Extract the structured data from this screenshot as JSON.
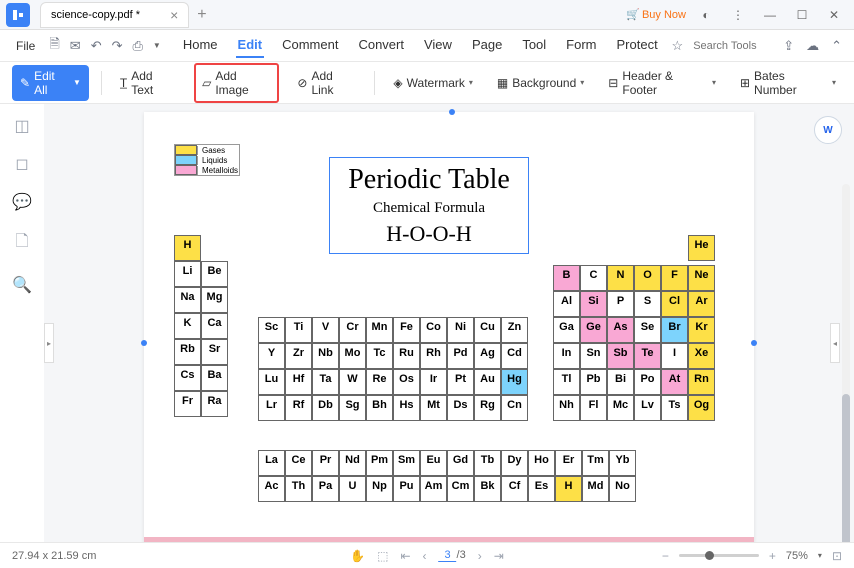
{
  "tab": {
    "title": "science-copy.pdf *"
  },
  "buy_now": "Buy Now",
  "menu": {
    "file": "File",
    "tabs": [
      "Home",
      "Edit",
      "Comment",
      "Convert",
      "View",
      "Page",
      "Tool",
      "Form",
      "Protect"
    ],
    "active": "Edit",
    "search": "Search Tools"
  },
  "toolbar": {
    "edit_all": "Edit All",
    "add_text": "Add Text",
    "add_image": "Add Image",
    "add_link": "Add Link",
    "watermark": "Watermark",
    "background": "Background",
    "header_footer": "Header & Footer",
    "bates_number": "Bates Number"
  },
  "legend": [
    {
      "label": "Gases",
      "color": "#fde047"
    },
    {
      "label": "Liquids",
      "color": "#7dd3fc"
    },
    {
      "label": "Metalloids",
      "color": "#f9a8d4"
    }
  ],
  "title_box": {
    "title": "Periodic Table",
    "sub": "Chemical Formula",
    "formula": "H-O-O-H"
  },
  "elements": {
    "group1": [
      [
        "H"
      ],
      [
        "Li",
        "Be"
      ],
      [
        "Na",
        "Mg"
      ],
      [
        "K",
        "Ca"
      ],
      [
        "Rb",
        "Sr"
      ],
      [
        "Cs",
        "Ba"
      ],
      [
        "Fr",
        "Ra"
      ]
    ],
    "block_d": [
      [
        "Sc",
        "Ti",
        "V",
        "Cr",
        "Mn",
        "Fe",
        "Co",
        "Ni",
        "Cu",
        "Zn"
      ],
      [
        "Y",
        "Zr",
        "Nb",
        "Mo",
        "Tc",
        "Ru",
        "Rh",
        "Pd",
        "Ag",
        "Cd"
      ],
      [
        "Lu",
        "Hf",
        "Ta",
        "W",
        "Re",
        "Os",
        "Ir",
        "Pt",
        "Au",
        "Hg"
      ],
      [
        "Lr",
        "Rf",
        "Db",
        "Sg",
        "Bh",
        "Hs",
        "Mt",
        "Ds",
        "Rg",
        "Cn"
      ]
    ],
    "block_p": [
      [
        "B",
        "C",
        "N",
        "O",
        "F",
        "Ne"
      ],
      [
        "Al",
        "Si",
        "P",
        "S",
        "Cl",
        "Ar"
      ],
      [
        "Ga",
        "Ge",
        "As",
        "Se",
        "Br",
        "Kr"
      ],
      [
        "In",
        "Sn",
        "Sb",
        "Te",
        "I",
        "Xe"
      ],
      [
        "Tl",
        "Pb",
        "Bi",
        "Po",
        "At",
        "Rn"
      ],
      [
        "Nh",
        "Fl",
        "Mc",
        "Lv",
        "Ts",
        "Og"
      ]
    ],
    "he": "He",
    "lanth": [
      [
        "La",
        "Ce",
        "Pr",
        "Nd",
        "Pm",
        "Sm",
        "Eu",
        "Gd",
        "Tb",
        "Dy",
        "Ho",
        "Er",
        "Tm",
        "Yb"
      ],
      [
        "Ac",
        "Th",
        "Pa",
        "U",
        "Np",
        "Pu",
        "Am",
        "Cm",
        "Bk",
        "Cf",
        "Es",
        "H",
        "Md",
        "No"
      ]
    ]
  },
  "colormap": {
    "H": "yellow",
    "He": "yellow",
    "N": "yellow",
    "O": "yellow",
    "F": "yellow",
    "Ne": "yellow",
    "Cl": "yellow",
    "Ar": "yellow",
    "Kr": "yellow",
    "Xe": "yellow",
    "Rn": "yellow",
    "Og": "yellow",
    "Br": "cyan",
    "Hg": "cyan",
    "B": "pink",
    "Si": "pink",
    "Ge": "pink",
    "As": "pink",
    "Sb": "pink",
    "Te": "pink",
    "At": "pink"
  },
  "page_num": "03",
  "status": {
    "dims": "27.94 x 21.59 cm",
    "page": "3",
    "total": "/3",
    "zoom": "75%"
  }
}
